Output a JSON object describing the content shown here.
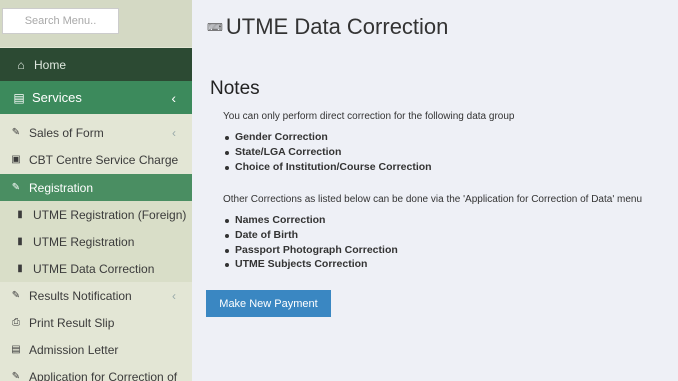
{
  "sidebar": {
    "search_placeholder": "Search Menu..",
    "home_label": "Home",
    "services_label": "Services",
    "items": [
      {
        "label": "Sales of Form"
      },
      {
        "label": "CBT Centre Service Charge"
      },
      {
        "label": "Registration"
      },
      {
        "label": "UTME Registration (Foreign)"
      },
      {
        "label": "UTME Registration"
      },
      {
        "label": "UTME Data Correction"
      },
      {
        "label": "Results Notification"
      },
      {
        "label": "Print Result Slip"
      },
      {
        "label": "Admission Letter"
      },
      {
        "label": "Application for Correction of"
      }
    ]
  },
  "main": {
    "page_title": "UTME Data Correction",
    "notes_heading": "Notes",
    "intro_text": "You can only perform direct correction for the following data group",
    "direct_list": [
      "Gender Correction",
      "State/LGA Correction",
      "Choice of Institution/Course Correction"
    ],
    "other_text": "Other Corrections as listed below can be done via the 'Application for Correction of Data' menu",
    "other_list": [
      "Names Correction",
      "Date of Birth",
      "Passport Photograph Correction",
      "UTME Subjects Correction"
    ],
    "button_label": "Make New Payment"
  },
  "colors": {
    "home_bg": "#2c4a33",
    "services_bg": "#3c8a5c",
    "registration_bg": "#4a8e62",
    "button_bg": "#3a87c2"
  }
}
